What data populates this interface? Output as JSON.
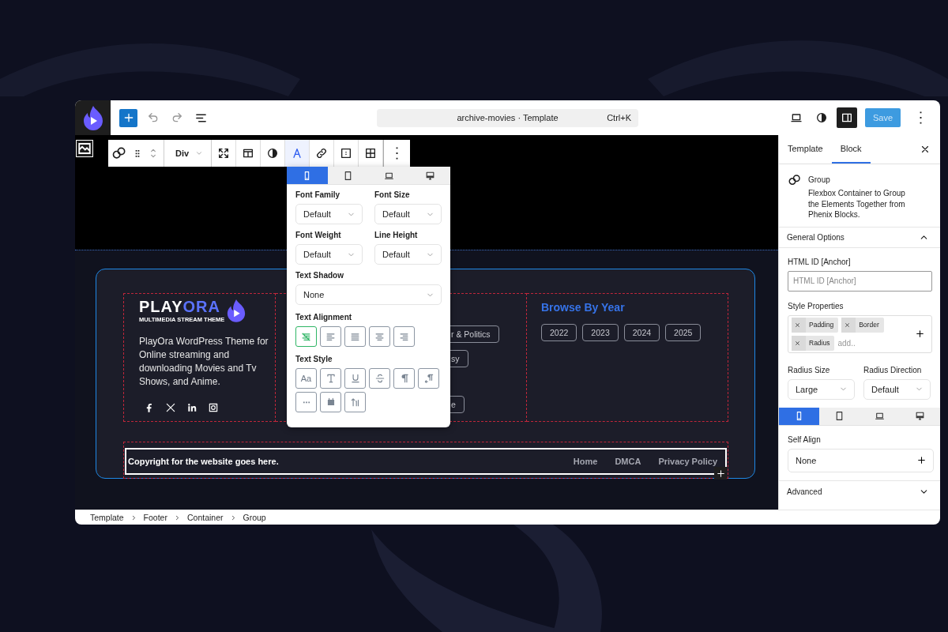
{
  "editor_bar": {
    "document_title": "archive-movies · Template",
    "shortcut": "Ctrl+K",
    "save_button": {
      "label": "Save",
      "disabled": true
    }
  },
  "block_toolbar": {
    "block_type": "Div",
    "tools": [
      {
        "kind": "expand",
        "selected": false
      },
      {
        "kind": "columns",
        "selected": false
      },
      {
        "kind": "contrast",
        "selected": false
      },
      {
        "kind": "typography",
        "selected": true
      },
      {
        "kind": "link",
        "selected": false
      },
      {
        "kind": "spacing",
        "selected": false
      },
      {
        "kind": "grid",
        "selected": false
      }
    ]
  },
  "typography_popover": {
    "devices": [
      {
        "kind": "mobile",
        "selected": true
      },
      {
        "kind": "tablet",
        "selected": false
      },
      {
        "kind": "laptop",
        "selected": false
      },
      {
        "kind": "desktop",
        "selected": false
      }
    ],
    "fields": [
      {
        "label": "Font Family",
        "value": "Default"
      },
      {
        "label": "Font Size",
        "value": "Default"
      },
      {
        "label": "Font Weight",
        "value": "Default"
      },
      {
        "label": "Line Height",
        "value": "Default"
      }
    ],
    "text_shadow": {
      "label": "Text Shadow",
      "value": "None"
    },
    "text_alignment": {
      "label": "Text Alignment",
      "options": [
        {
          "kind": "none",
          "selected": true
        },
        {
          "kind": "left",
          "selected": false
        },
        {
          "kind": "justify",
          "selected": false
        },
        {
          "kind": "center",
          "selected": false
        },
        {
          "kind": "right",
          "selected": false
        }
      ]
    },
    "text_style": {
      "label": "Text Style",
      "options": [
        {
          "kind": "case",
          "label": "Aa"
        },
        {
          "kind": "text"
        },
        {
          "kind": "underline"
        },
        {
          "kind": "strikethrough"
        },
        {
          "kind": "paragraph"
        },
        {
          "kind": "paragraph-direction"
        },
        {
          "kind": "more"
        },
        {
          "kind": "box"
        },
        {
          "kind": "letter-spacing"
        }
      ]
    }
  },
  "footer": {
    "logo": {
      "name": "PLAY",
      "accent": "ORA",
      "tagline": "MULTIMEDIA STREAM THEME"
    },
    "description": "PlayOra WordPress Theme for Online streaming and downloading Movies and Tv Shows, and Anime.",
    "socials": [
      {
        "kind": "facebook"
      },
      {
        "kind": "x"
      },
      {
        "kind": "linkedin"
      },
      {
        "kind": "instagram"
      }
    ],
    "genre_tags": [
      "r & Politics",
      "sy",
      "e"
    ],
    "year_heading": "Browse By Year",
    "years": [
      "2022",
      "2023",
      "2024",
      "2025"
    ],
    "copyright": "Copyright for the website goes here.",
    "links": [
      "Home",
      "DMCA",
      "Privacy Policy"
    ]
  },
  "sidebar": {
    "tabs": [
      {
        "label": "Template",
        "selected": false
      },
      {
        "label": "Block",
        "selected": true
      }
    ],
    "block": {
      "title": "Group",
      "description": "Flexbox Container to Group the Elements Together from Phenix Blocks."
    },
    "general_options": {
      "title": "General Options",
      "expanded": true
    },
    "html_id": {
      "label": "HTML ID [Anchor]",
      "placeholder": "HTML ID [Anchor]"
    },
    "style_properties": {
      "label": "Style Properties",
      "tags": [
        "Padding",
        "Border",
        "Radius"
      ],
      "placeholder": "add.."
    },
    "radius_size": {
      "label": "Radius Size",
      "value": "Large"
    },
    "radius_direction": {
      "label": "Radius Direction",
      "value": "Default"
    },
    "devices": [
      {
        "kind": "mobile",
        "selected": true
      },
      {
        "kind": "tablet",
        "selected": false
      },
      {
        "kind": "laptop",
        "selected": false
      },
      {
        "kind": "desktop",
        "selected": false
      }
    ],
    "self_align": {
      "label": "Self Align",
      "value": "None"
    },
    "advanced": {
      "title": "Advanced",
      "expanded": false
    }
  },
  "breadcrumb": [
    "Template",
    "Footer",
    "Container",
    "Group"
  ]
}
